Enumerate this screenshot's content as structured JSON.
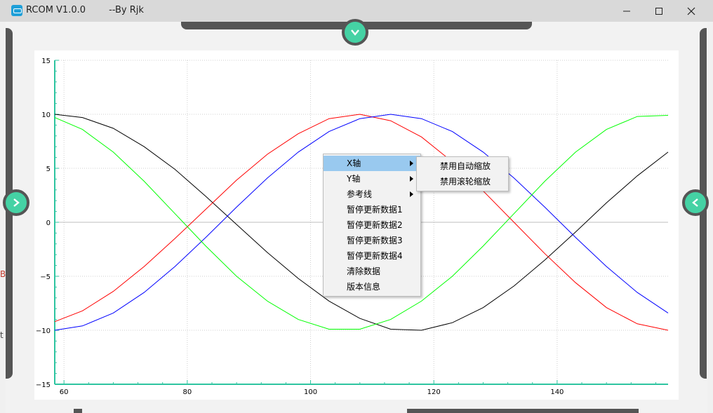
{
  "window": {
    "title": "RCOM V1.0.0        --By Rjk",
    "controls": [
      "minimize",
      "maximize",
      "close"
    ]
  },
  "icons": {
    "app": "terminal-icon",
    "top_toggle": "chevron-down-icon",
    "left_toggle": "chevron-right-icon",
    "right_toggle": "chevron-left-icon"
  },
  "colors": {
    "accent": "#45d2a4",
    "drawer": "#555555",
    "axis": "#2ec4a0",
    "menu_highlight": "#99c9ef"
  },
  "background_fragments": {
    "left_a": "B",
    "left_b": "t"
  },
  "context_menu": {
    "items": [
      {
        "label": "X轴",
        "has_submenu": true,
        "highlighted": true
      },
      {
        "label": "Y轴",
        "has_submenu": true
      },
      {
        "label": "参考线",
        "has_submenu": true
      },
      {
        "label": "暂停更新数据1"
      },
      {
        "label": "暂停更新数据2"
      },
      {
        "label": "暂停更新数据3"
      },
      {
        "label": "暂停更新数据4"
      },
      {
        "label": "清除数据"
      },
      {
        "label": "版本信息"
      }
    ],
    "submenu": {
      "items": [
        {
          "label": "禁用自动缩放"
        },
        {
          "label": "禁用滚轮缩放"
        }
      ]
    }
  },
  "chart_data": {
    "type": "line",
    "xlim": [
      58.5,
      158
    ],
    "ylim": [
      -15,
      15
    ],
    "x_ticks": [
      60,
      80,
      100,
      120,
      140
    ],
    "y_ticks": [
      15,
      10,
      5,
      0,
      -5,
      -10,
      -15
    ],
    "y_tick_labels": [
      "15",
      "10",
      "5",
      "0",
      "−5",
      "−10",
      "−15"
    ],
    "grid": true,
    "series": [
      {
        "color": "#000000",
        "x": [
          58.5,
          63,
          68,
          73,
          78,
          83,
          88,
          93,
          98,
          103,
          108,
          113,
          118,
          123,
          128,
          133,
          138,
          143,
          148,
          153,
          158
        ],
        "y": [
          10.0,
          9.7,
          8.7,
          7.0,
          4.9,
          2.4,
          -0.2,
          -2.8,
          -5.2,
          -7.3,
          -8.9,
          -9.9,
          -10.0,
          -9.3,
          -7.9,
          -5.9,
          -3.5,
          -0.9,
          1.8,
          4.3,
          6.5
        ]
      },
      {
        "color": "#ff0000",
        "x": [
          58.5,
          63,
          68,
          73,
          78,
          83,
          88,
          93,
          98,
          103,
          108,
          113,
          118,
          123,
          128,
          133,
          138,
          143,
          148,
          153,
          158
        ],
        "y": [
          -9.2,
          -8.2,
          -6.4,
          -4.1,
          -1.5,
          1.2,
          3.9,
          6.3,
          8.2,
          9.6,
          10.0,
          9.4,
          7.9,
          5.6,
          2.9,
          0.0,
          -2.9,
          -5.6,
          -7.9,
          -9.4,
          -10.0
        ]
      },
      {
        "color": "#0000ff",
        "x": [
          58.5,
          63,
          68,
          73,
          78,
          83,
          88,
          93,
          98,
          103,
          108,
          113,
          118,
          123,
          128,
          133,
          138,
          143,
          148,
          153,
          158
        ],
        "y": [
          -10.0,
          -9.6,
          -8.4,
          -6.5,
          -4.1,
          -1.4,
          1.4,
          4.1,
          6.5,
          8.4,
          9.6,
          10.0,
          9.6,
          8.4,
          6.5,
          4.1,
          1.4,
          -1.4,
          -4.1,
          -6.5,
          -8.4
        ]
      },
      {
        "color": "#00ff00",
        "x": [
          58.5,
          63,
          68,
          73,
          78,
          83,
          88,
          93,
          98,
          103,
          108,
          113,
          118,
          123,
          128,
          133,
          138,
          143,
          148,
          153,
          158
        ],
        "y": [
          9.7,
          8.6,
          6.5,
          3.8,
          0.8,
          -2.2,
          -5.0,
          -7.3,
          -9.0,
          -9.9,
          -9.9,
          -9.0,
          -7.3,
          -5.0,
          -2.2,
          0.8,
          3.8,
          6.5,
          8.6,
          9.8,
          9.9
        ]
      }
    ]
  }
}
